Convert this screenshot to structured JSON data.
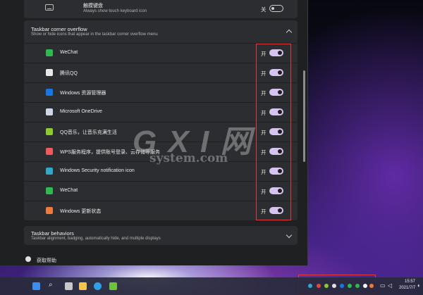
{
  "touch_keyboard": {
    "title": "触摸键盘",
    "subtitle": "Always show touch keyboard icon",
    "state": "关"
  },
  "overflow": {
    "title": "Taskbar corner overflow",
    "subtitle": "Show or hide icons that appear in the taskbar corner overflow menu",
    "items": [
      {
        "label": "WeChat",
        "state": "开",
        "icon": "wechat-icon",
        "color": "#2dbb4f"
      },
      {
        "label": "腾讯QQ",
        "state": "开",
        "icon": "qq-penguin-icon",
        "color": "#e8e8e8"
      },
      {
        "label": "Windows 资源管理器",
        "state": "开",
        "icon": "bluetooth-icon",
        "color": "#1677e6"
      },
      {
        "label": "Microsoft OneDrive",
        "state": "开",
        "icon": "onedrive-cloud-icon",
        "color": "#cfd6e6"
      },
      {
        "label": "QQ音乐，让音乐充满生活",
        "state": "开",
        "icon": "qq-music-icon",
        "color": "#8bcc2c"
      },
      {
        "label": "WPS服务程序，提供账号登录、云存储等服务",
        "state": "开",
        "icon": "wps-icon",
        "color": "#f05a5a"
      },
      {
        "label": "Windows Security notification icon",
        "state": "开",
        "icon": "windows-security-icon",
        "color": "#2fa8c9"
      },
      {
        "label": "WeChat",
        "state": "开",
        "icon": "wechat-icon",
        "color": "#2dbb4f"
      },
      {
        "label": "Windows 更新状态",
        "state": "开",
        "icon": "windows-update-icon",
        "color": "#f07a3a"
      }
    ]
  },
  "behaviors": {
    "title": "Taskbar behaviors",
    "subtitle": "Taskbar alignment, badging, automatically hide, and multiple displays"
  },
  "help": {
    "label": "获取帮助"
  },
  "watermark": {
    "big": "G X I 网",
    "small": "system.com"
  },
  "taskbar": {
    "time": "15:57",
    "date": "2021/7/7"
  },
  "colors": {
    "toggle_on": "#d7c3f0",
    "annotation": "#e23b3b",
    "card": "#2b2d30",
    "window": "#1e2022"
  }
}
